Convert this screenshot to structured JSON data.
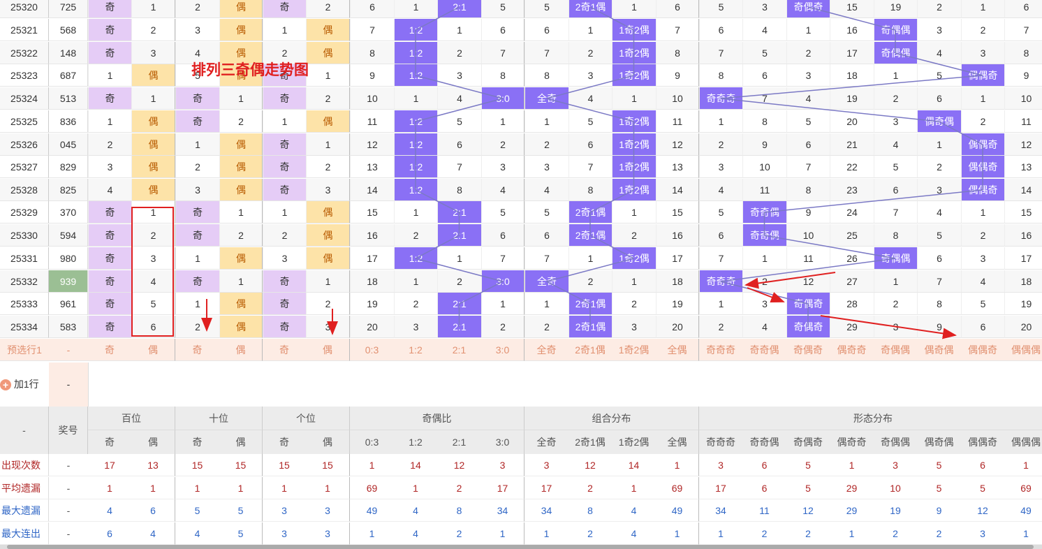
{
  "title": "排列三奇偶走势图",
  "rows": [
    {
      "issue": "25320",
      "num": "725",
      "cells": [
        "奇",
        "1",
        "2",
        "偶",
        "奇",
        "2",
        "6",
        "1",
        "2:1",
        "5",
        "5",
        "2奇1偶",
        "1",
        "6",
        "5",
        "3",
        "奇偶奇",
        "15",
        "19",
        "2",
        "1",
        "6"
      ]
    },
    {
      "issue": "25321",
      "num": "568",
      "cells": [
        "奇",
        "2",
        "3",
        "偶",
        "1",
        "偶",
        "7",
        "1:2",
        "1",
        "6",
        "6",
        "1",
        "1奇2偶",
        "7",
        "6",
        "4",
        "1",
        "16",
        "奇偶偶",
        "3",
        "2",
        "7"
      ]
    },
    {
      "issue": "25322",
      "num": "148",
      "cells": [
        "奇",
        "3",
        "4",
        "偶",
        "2",
        "偶",
        "8",
        "1:2",
        "2",
        "7",
        "7",
        "2",
        "1奇2偶",
        "8",
        "7",
        "5",
        "2",
        "17",
        "奇偶偶",
        "4",
        "3",
        "8"
      ]
    },
    {
      "issue": "25323",
      "num": "687",
      "cells": [
        "1",
        "偶",
        "5",
        "偶",
        "奇",
        "1",
        "9",
        "1:2",
        "3",
        "8",
        "8",
        "3",
        "1奇2偶",
        "9",
        "8",
        "6",
        "3",
        "18",
        "1",
        "5",
        "偶偶奇",
        "9"
      ]
    },
    {
      "issue": "25324",
      "num": "513",
      "cells": [
        "奇",
        "1",
        "奇",
        "1",
        "奇",
        "2",
        "10",
        "1",
        "4",
        "3:0",
        "全奇",
        "4",
        "1",
        "10",
        "奇奇奇",
        "7",
        "4",
        "19",
        "2",
        "6",
        "1",
        "10"
      ]
    },
    {
      "issue": "25325",
      "num": "836",
      "cells": [
        "1",
        "偶",
        "奇",
        "2",
        "1",
        "偶",
        "11",
        "1:2",
        "5",
        "1",
        "1",
        "5",
        "1奇2偶",
        "11",
        "1",
        "8",
        "5",
        "20",
        "3",
        "偶奇偶",
        "2",
        "11"
      ]
    },
    {
      "issue": "25326",
      "num": "045",
      "cells": [
        "2",
        "偶",
        "1",
        "偶",
        "奇",
        "1",
        "12",
        "1:2",
        "6",
        "2",
        "2",
        "6",
        "1奇2偶",
        "12",
        "2",
        "9",
        "6",
        "21",
        "4",
        "1",
        "偶偶奇",
        "12"
      ]
    },
    {
      "issue": "25327",
      "num": "829",
      "cells": [
        "3",
        "偶",
        "2",
        "偶",
        "奇",
        "2",
        "13",
        "1:2",
        "7",
        "3",
        "3",
        "7",
        "1奇2偶",
        "13",
        "3",
        "10",
        "7",
        "22",
        "5",
        "2",
        "偶偶奇",
        "13"
      ]
    },
    {
      "issue": "25328",
      "num": "825",
      "cells": [
        "4",
        "偶",
        "3",
        "偶",
        "奇",
        "3",
        "14",
        "1:2",
        "8",
        "4",
        "4",
        "8",
        "1奇2偶",
        "14",
        "4",
        "11",
        "8",
        "23",
        "6",
        "3",
        "偶偶奇",
        "14"
      ]
    },
    {
      "issue": "25329",
      "num": "370",
      "cells": [
        "奇",
        "1",
        "奇",
        "1",
        "1",
        "偶",
        "15",
        "1",
        "2:1",
        "5",
        "5",
        "2奇1偶",
        "1",
        "15",
        "5",
        "奇奇偶",
        "9",
        "24",
        "7",
        "4",
        "1",
        "15"
      ]
    },
    {
      "issue": "25330",
      "num": "594",
      "cells": [
        "奇",
        "2",
        "奇",
        "2",
        "2",
        "偶",
        "16",
        "2",
        "2:1",
        "6",
        "6",
        "2奇1偶",
        "2",
        "16",
        "6",
        "奇奇偶",
        "10",
        "25",
        "8",
        "5",
        "2",
        "16"
      ]
    },
    {
      "issue": "25331",
      "num": "980",
      "cells": [
        "奇",
        "3",
        "1",
        "偶",
        "3",
        "偶",
        "17",
        "1:2",
        "1",
        "7",
        "7",
        "1",
        "1奇2偶",
        "17",
        "7",
        "1",
        "11",
        "26",
        "奇偶偶",
        "6",
        "3",
        "17"
      ]
    },
    {
      "issue": "25332",
      "num": "939",
      "cells": [
        "奇",
        "4",
        "奇",
        "1",
        "奇",
        "1",
        "18",
        "1",
        "2",
        "3:0",
        "全奇",
        "2",
        "1",
        "18",
        "奇奇奇",
        "2",
        "12",
        "27",
        "1",
        "7",
        "4",
        "18"
      ]
    },
    {
      "issue": "25333",
      "num": "961",
      "cells": [
        "奇",
        "5",
        "1",
        "偶",
        "奇",
        "2",
        "19",
        "2",
        "2:1",
        "1",
        "1",
        "2奇1偶",
        "2",
        "19",
        "1",
        "3",
        "奇偶奇",
        "28",
        "2",
        "8",
        "5",
        "19"
      ]
    },
    {
      "issue": "25334",
      "num": "583",
      "cells": [
        "奇",
        "6",
        "2",
        "偶",
        "奇",
        "3",
        "20",
        "3",
        "2:1",
        "2",
        "2",
        "2奇1偶",
        "3",
        "20",
        "2",
        "4",
        "奇偶奇",
        "29",
        "3",
        "9",
        "6",
        "20"
      ]
    }
  ],
  "preselect": {
    "label": "预选行1",
    "num": "-",
    "cells": [
      "奇",
      "偶",
      "奇",
      "偶",
      "奇",
      "偶",
      "0:3",
      "1:2",
      "2:1",
      "3:0",
      "全奇",
      "2奇1偶",
      "1奇2偶",
      "全偶",
      "奇奇奇",
      "奇奇偶",
      "奇偶奇",
      "偶奇奇",
      "奇偶偶",
      "偶奇偶",
      "偶偶奇",
      "偶偶偶"
    ]
  },
  "add_row": {
    "label": "加1行",
    "dash": "-"
  },
  "header": {
    "corner": "-",
    "issue_label": "奖号",
    "groups": [
      "百位",
      "十位",
      "个位",
      "奇偶比",
      "组合分布",
      "形态分布"
    ],
    "subs": [
      "奇",
      "偶",
      "奇",
      "偶",
      "奇",
      "偶",
      "0:3",
      "1:2",
      "2:1",
      "3:0",
      "全奇",
      "2奇1偶",
      "1奇2偶",
      "全偶",
      "奇奇奇",
      "奇奇偶",
      "奇偶奇",
      "偶奇奇",
      "奇偶偶",
      "偶奇偶",
      "偶偶奇",
      "偶偶偶"
    ]
  },
  "stats": [
    {
      "label": "出现次数",
      "dash": "-",
      "values": [
        "17",
        "13",
        "15",
        "15",
        "15",
        "15",
        "1",
        "14",
        "12",
        "3",
        "3",
        "12",
        "14",
        "1",
        "3",
        "6",
        "5",
        "1",
        "3",
        "5",
        "6",
        "1"
      ]
    },
    {
      "label": "平均遗漏",
      "dash": "-",
      "values": [
        "1",
        "1",
        "1",
        "1",
        "1",
        "1",
        "69",
        "1",
        "2",
        "17",
        "17",
        "2",
        "1",
        "69",
        "17",
        "6",
        "5",
        "29",
        "10",
        "5",
        "5",
        "69"
      ]
    },
    {
      "label": "最大遗漏",
      "dash": "-",
      "values": [
        "4",
        "6",
        "5",
        "5",
        "3",
        "3",
        "49",
        "4",
        "8",
        "34",
        "34",
        "8",
        "4",
        "49",
        "34",
        "11",
        "12",
        "29",
        "19",
        "9",
        "12",
        "49"
      ]
    },
    {
      "label": "最大连出",
      "dash": "-",
      "values": [
        "6",
        "4",
        "4",
        "5",
        "3",
        "3",
        "1",
        "4",
        "2",
        "1",
        "1",
        "2",
        "4",
        "1",
        "1",
        "2",
        "2",
        "1",
        "2",
        "2",
        "3",
        "1"
      ]
    }
  ],
  "colors": {
    "hit": "#8a70f5",
    "odd": "#e5ccf6",
    "even": "#fde3a8",
    "highlight": "#9bbf94",
    "arrow": "#e02020"
  }
}
